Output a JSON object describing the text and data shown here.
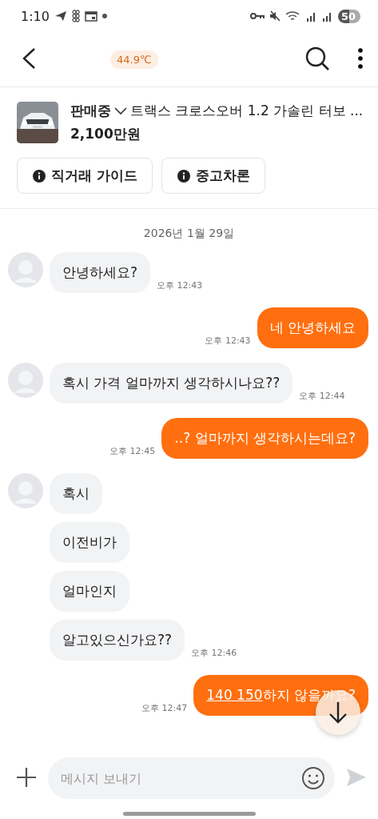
{
  "status_bar": {
    "time": "1:10",
    "battery": "50"
  },
  "top_bar": {
    "temperature": "44.9℃"
  },
  "product": {
    "status": "판매중",
    "title": "트랙스 크로스오버 1.2 가솔린 터보 ...",
    "price": "2,100만원",
    "buttons": [
      "직거래 가이드",
      "중고차론"
    ]
  },
  "messages": [
    {
      "kind": "date",
      "text": "2026년 1월 29일"
    },
    {
      "kind": "received",
      "text": "안녕하세요?",
      "time": "오후 12:43",
      "show_avatar": true
    },
    {
      "kind": "sent",
      "text": "네 안녕하세요",
      "time": "오후 12:43"
    },
    {
      "kind": "received",
      "text": "혹시 가격 얼마까지 생각하시나요??",
      "time": "오후 12:44",
      "show_avatar": true
    },
    {
      "kind": "sent",
      "text": "..? 얼마까지 생각하시는데요?",
      "time": "오후 12:45"
    },
    {
      "kind": "received",
      "text": "혹시",
      "show_avatar": true
    },
    {
      "kind": "received",
      "text": "이전비가",
      "show_avatar": false
    },
    {
      "kind": "received",
      "text": "얼마인지",
      "show_avatar": false
    },
    {
      "kind": "received",
      "text": "알고있으신가요??",
      "time": "오후 12:46",
      "show_avatar": false
    },
    {
      "kind": "sent",
      "link": "140 150",
      "text": "하지 않을까요?",
      "time": "오후 12:47"
    }
  ],
  "composer": {
    "placeholder": "메시지 보내기"
  }
}
